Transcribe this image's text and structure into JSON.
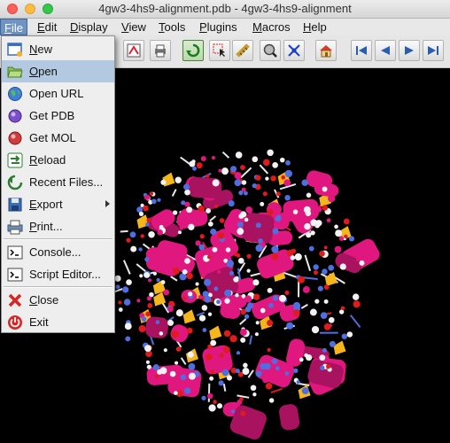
{
  "window": {
    "title": "4gw3-4hs9-alignment.pdb - 4gw3-4hs9-alignment"
  },
  "menubar": {
    "items": [
      {
        "label": "File",
        "mnemonic": "F",
        "rest": "ile"
      },
      {
        "label": "Edit",
        "mnemonic": "E",
        "rest": "dit"
      },
      {
        "label": "Display",
        "mnemonic": "D",
        "rest": "isplay"
      },
      {
        "label": "View",
        "mnemonic": "V",
        "rest": "iew"
      },
      {
        "label": "Tools",
        "mnemonic": "T",
        "rest": "ools"
      },
      {
        "label": "Plugins",
        "mnemonic": "P",
        "rest": "lugins"
      },
      {
        "label": "Macros",
        "mnemonic": "M",
        "rest": "acros"
      },
      {
        "label": "Help",
        "mnemonic": "H",
        "rest": "elp"
      }
    ]
  },
  "toolbar": {
    "icons": [
      "save-icon",
      "print-icon",
      "rotate-icon",
      "select-icon",
      "measure-icon",
      "zoom-icon",
      "center-icon",
      "home-icon",
      "first-frame-icon",
      "prev-frame-icon",
      "next-frame-icon",
      "last-frame-icon"
    ]
  },
  "file_menu": {
    "items": [
      {
        "label": "New",
        "mnemonic": "N",
        "rest": "ew",
        "icon": "new-file-icon"
      },
      {
        "label": "Open",
        "mnemonic": "O",
        "rest": "pen",
        "icon": "open-folder-icon",
        "highlighted": true
      },
      {
        "label": "Open URL",
        "mnemonic": "",
        "rest": "Open URL",
        "icon": "globe-icon"
      },
      {
        "label": "Get PDB",
        "mnemonic": "",
        "rest": "Get PDB",
        "icon": "pdb-molecule-icon"
      },
      {
        "label": "Get MOL",
        "mnemonic": "",
        "rest": "Get MOL",
        "icon": "mol-molecule-icon"
      },
      {
        "label": "Reload",
        "mnemonic": "R",
        "rest": "eload",
        "icon": "reload-icon"
      },
      {
        "label": "Recent Files...",
        "mnemonic": "",
        "rest": "Recent Files...",
        "icon": "recent-files-icon",
        "submenu": true
      },
      {
        "label": "Export",
        "mnemonic": "E",
        "rest": "xport",
        "icon": "export-icon",
        "submenu": true
      },
      {
        "label": "Print...",
        "mnemonic": "P",
        "rest": "rint...",
        "icon": "printer-icon"
      },
      {
        "label": "Console...",
        "mnemonic": "",
        "rest": "Console...",
        "icon": "console-icon"
      },
      {
        "label": "Script Editor...",
        "mnemonic": "",
        "rest": "Script Editor...",
        "icon": "script-editor-icon"
      },
      {
        "label": "Close",
        "mnemonic": "C",
        "rest": "lose",
        "icon": "close-x-icon"
      },
      {
        "label": "Exit",
        "mnemonic": "",
        "rest": "Exit",
        "icon": "power-exit-icon"
      }
    ]
  },
  "colors": {
    "background": "#000000",
    "helix": "#e0177f",
    "sheet": "#f5b51c",
    "oxygen": "#e01b1b",
    "nitrogen": "#4f6fe0",
    "carbon": "#f2f2f2",
    "menu_highlight": "#b3c9e1"
  }
}
